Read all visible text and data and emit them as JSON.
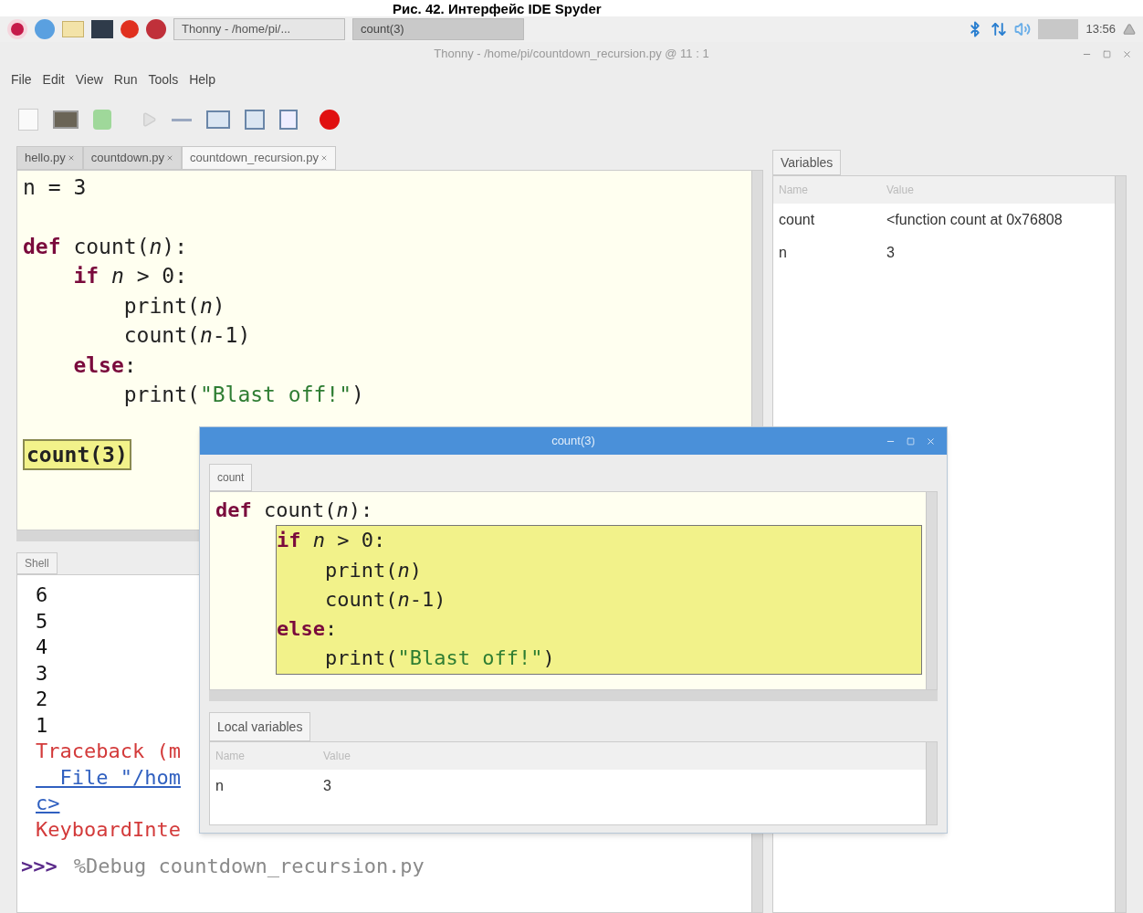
{
  "caption": "Рис. 42. Интерфейс IDE Spyder",
  "taskbar": {
    "tasks": [
      {
        "label": "Thonny - /home/pi/...",
        "selected": false
      },
      {
        "label": "count(3)",
        "selected": true
      }
    ],
    "clock": "13:56"
  },
  "window": {
    "title": "Thonny - /home/pi/countdown_recursion.py @ 11 : 1"
  },
  "menu": [
    "File",
    "Edit",
    "View",
    "Run",
    "Tools",
    "Help"
  ],
  "editor_tabs": [
    {
      "label": "hello.py",
      "selected": false
    },
    {
      "label": "countdown.py",
      "selected": false
    },
    {
      "label": "countdown_recursion.py",
      "selected": true
    }
  ],
  "editor": {
    "blocks": [
      {
        "lines": [
          {
            "tokens": [
              {
                "kind": "text",
                "t": "n = 3"
              }
            ]
          }
        ]
      },
      {
        "lines": [
          {
            "tokens": [
              {
                "kind": "kw",
                "t": "def"
              },
              {
                "kind": "text",
                "t": " count("
              },
              {
                "kind": "param",
                "t": "n"
              },
              {
                "kind": "text",
                "t": "):"
              }
            ]
          },
          {
            "tokens": [
              {
                "kind": "kw",
                "t": "    if "
              },
              {
                "kind": "param",
                "t": "n"
              },
              {
                "kind": "text",
                "t": " > 0:"
              }
            ]
          },
          {
            "tokens": [
              {
                "kind": "text",
                "t": "        print("
              },
              {
                "kind": "param",
                "t": "n"
              },
              {
                "kind": "text",
                "t": ")"
              }
            ]
          },
          {
            "tokens": [
              {
                "kind": "text",
                "t": "        count("
              },
              {
                "kind": "param",
                "t": "n"
              },
              {
                "kind": "text",
                "t": "-1)"
              }
            ]
          },
          {
            "tokens": [
              {
                "kind": "kw",
                "t": "    else"
              },
              {
                "kind": "text",
                "t": ":"
              }
            ]
          },
          {
            "tokens": [
              {
                "kind": "text",
                "t": "        print("
              },
              {
                "kind": "str",
                "t": "\"Blast off!\""
              },
              {
                "kind": "text",
                "t": ")"
              }
            ]
          }
        ]
      }
    ],
    "current_call": "count(3)"
  },
  "shell": {
    "tab": "Shell",
    "lines": [
      {
        "kind": "output",
        "text": "6"
      },
      {
        "kind": "output",
        "text": "5"
      },
      {
        "kind": "output",
        "text": "4"
      },
      {
        "kind": "output",
        "text": "3"
      },
      {
        "kind": "output",
        "text": "2"
      },
      {
        "kind": "output",
        "text": "1"
      },
      {
        "kind": "error",
        "text": "Traceback (m"
      },
      {
        "kind": "link",
        "text": "  File \"/hom"
      },
      {
        "kind": "link",
        "text": "c>"
      },
      {
        "kind": "error",
        "text": "KeyboardInte"
      }
    ],
    "prompt": ">>>",
    "command": "%Debug countdown_recursion.py"
  },
  "variables": {
    "tab": "Variables",
    "columns": [
      "Name",
      "Value"
    ],
    "rows": [
      [
        "count",
        "<function count at 0x76808"
      ],
      [
        "n",
        "3"
      ]
    ]
  },
  "dialog": {
    "title": "count(3)",
    "tab": "count",
    "before": [
      {
        "tokens": [
          {
            "kind": "kw",
            "t": "def"
          },
          {
            "kind": "text",
            "t": " count("
          },
          {
            "kind": "param",
            "t": "n"
          },
          {
            "kind": "text",
            "t": "):"
          }
        ]
      }
    ],
    "focus": [
      {
        "tokens": [
          {
            "kind": "kw",
            "t": "if "
          },
          {
            "kind": "param",
            "t": "n"
          },
          {
            "kind": "text",
            "t": " > 0:"
          }
        ]
      },
      {
        "tokens": [
          {
            "kind": "text",
            "t": "    print("
          },
          {
            "kind": "param",
            "t": "n"
          },
          {
            "kind": "text",
            "t": ")"
          }
        ]
      },
      {
        "tokens": [
          {
            "kind": "text",
            "t": "    count("
          },
          {
            "kind": "param",
            "t": "n"
          },
          {
            "kind": "text",
            "t": "-1)"
          }
        ]
      },
      {
        "tokens": [
          {
            "kind": "kw",
            "t": "else"
          },
          {
            "kind": "text",
            "t": ":"
          }
        ]
      },
      {
        "tokens": [
          {
            "kind": "text",
            "t": "    print("
          },
          {
            "kind": "str",
            "t": "\"Blast off!\""
          },
          {
            "kind": "text",
            "t": ")"
          }
        ]
      }
    ],
    "locals": {
      "tab": "Local variables",
      "columns": [
        "Name",
        "Value"
      ],
      "rows": [
        [
          "n",
          "3"
        ]
      ]
    }
  }
}
